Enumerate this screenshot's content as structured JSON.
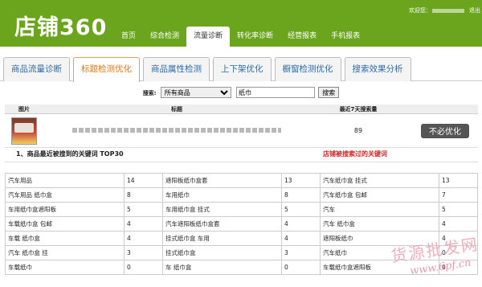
{
  "header": {
    "logo": "店铺360",
    "welcome": "欢迎您：",
    "logout": "退出"
  },
  "nav": [
    "首页",
    "综合检测",
    "流量诊断",
    "转化率诊断",
    "经营报表",
    "手机报表"
  ],
  "tabs": [
    "商品流量诊断",
    "标题检测优化",
    "商品属性检测",
    "上下架优化",
    "橱窗检测优化",
    "搜索效果分析"
  ],
  "search": {
    "label": "搜索:",
    "select_value": "所有商品",
    "keyword": "纸巾",
    "button": "搜索"
  },
  "product_table": {
    "headers": [
      "图片",
      "标题",
      "最近7天搜索量"
    ],
    "sales": "89",
    "button": "不必优化"
  },
  "section": {
    "title": "1、商品最近被搜到的关键词 TOP30",
    "note": "店铺被搜索过的关键词"
  },
  "keywords": [
    [
      {
        "kw": "汽车用品",
        "n": "14"
      },
      {
        "kw": "遮阳板纸巾盒套",
        "n": "13"
      },
      {
        "kw": "汽车纸巾盒 挂式",
        "n": "13"
      }
    ],
    [
      {
        "kw": "汽车用品 纸巾盒",
        "n": "8"
      },
      {
        "kw": "车用纸巾",
        "n": "8"
      },
      {
        "kw": "汽车纸巾盒 包邮",
        "n": "7"
      }
    ],
    [
      {
        "kw": "车用纸巾盒遮阳板",
        "n": "5"
      },
      {
        "kw": "车用纸巾盒 挂式",
        "n": "5"
      },
      {
        "kw": "汽车",
        "n": "5"
      }
    ],
    [
      {
        "kw": "车载纸巾盒 包邮",
        "n": "4"
      },
      {
        "kw": "汽车遮阳板纸巾盒套",
        "n": "4"
      },
      {
        "kw": "汽车 纸巾盒",
        "n": "4"
      }
    ],
    [
      {
        "kw": "车载 纸巾盒",
        "n": "4"
      },
      {
        "kw": "挂式纸巾盒 车用",
        "n": "4"
      },
      {
        "kw": "遮阳板纸巾",
        "n": "4"
      }
    ],
    [
      {
        "kw": "汽车 纸巾盒 挂",
        "n": "3"
      },
      {
        "kw": "挂式纸巾盒",
        "n": "3"
      },
      {
        "kw": "汽车纸巾",
        "n": "0"
      }
    ],
    [
      {
        "kw": "车载纸巾",
        "n": "0"
      },
      {
        "kw": "车 纸巾盒",
        "n": "0"
      },
      {
        "kw": "车载纸巾盒遮阳板",
        "n": "0"
      }
    ]
  ],
  "watermark": {
    "line1": "货源批发网",
    "line2": "www.6pf.cn"
  }
}
